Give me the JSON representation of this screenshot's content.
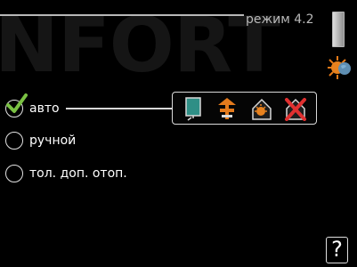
{
  "header": {
    "title": "режим 4.2",
    "watermark": "NFORT"
  },
  "options": [
    {
      "label": "авто",
      "selected": true
    },
    {
      "label": "ручной",
      "selected": false
    },
    {
      "label": "тол. доп. отоп.",
      "selected": false
    }
  ],
  "function_icons": [
    "heating-panel-icon",
    "additional-heat-icon",
    "hot-water-icon",
    "disabled-icon"
  ],
  "help": {
    "label": "?"
  },
  "colors": {
    "background": "#000000",
    "check_green": "#7ac143",
    "icon_teal": "#2f8f86",
    "icon_orange": "#e47a1c",
    "disabled_red": "#e03030"
  }
}
